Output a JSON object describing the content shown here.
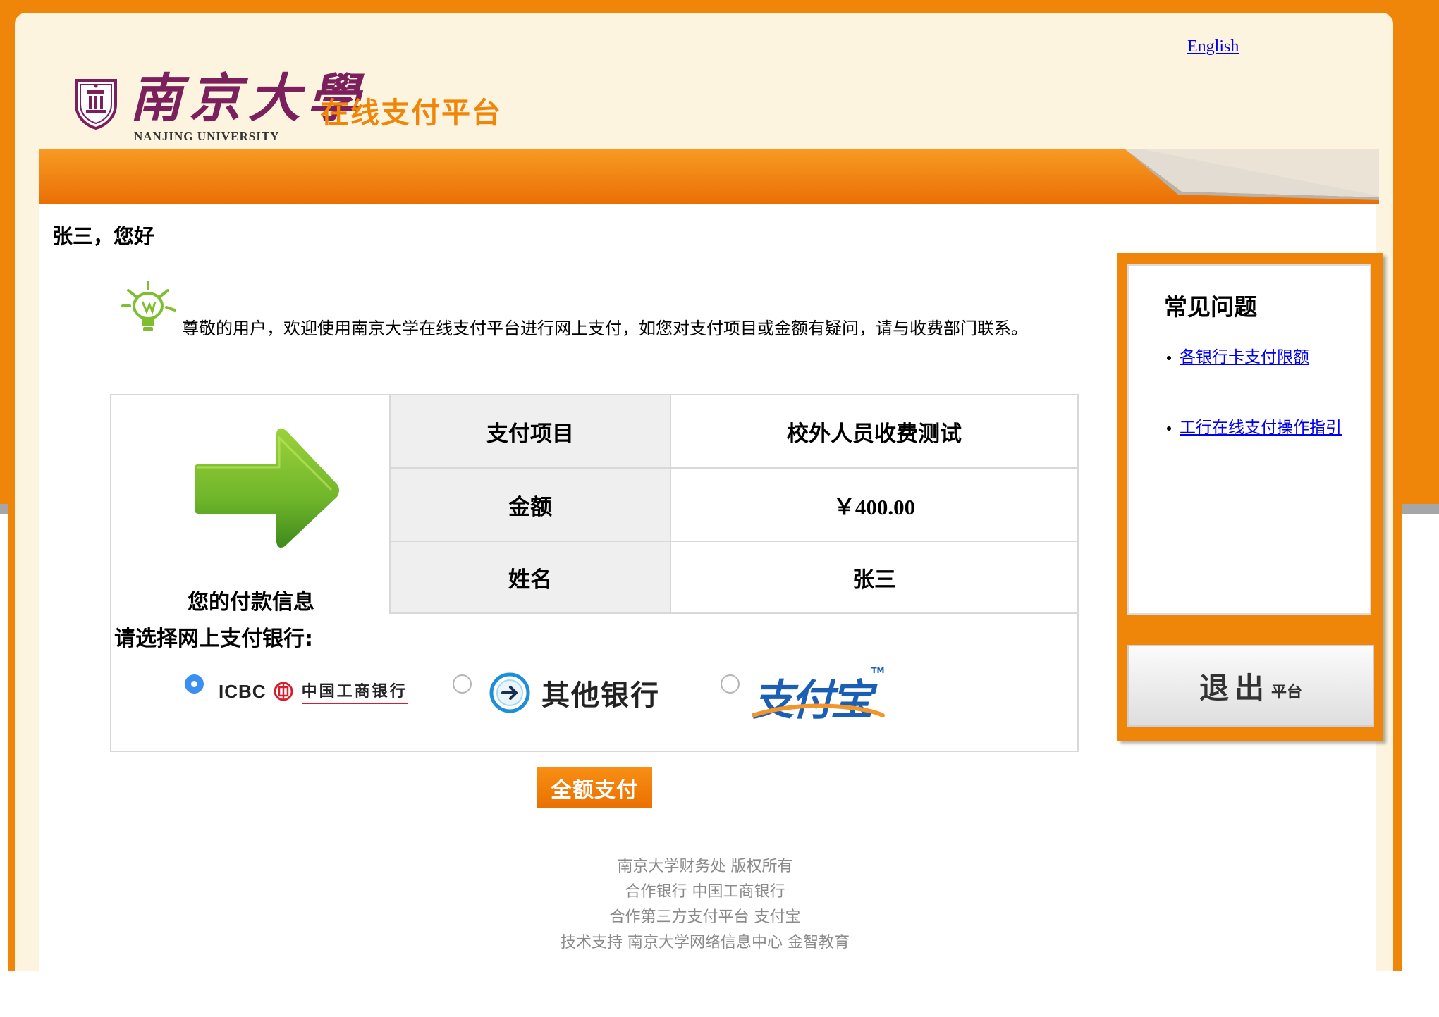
{
  "header": {
    "language_link": "English",
    "logo_cn": "南京大學",
    "logo_en": "NANJING UNIVERSITY",
    "platform_title": "在线支付平台"
  },
  "greeting": "张三，您好",
  "welcome_message": "尊敬的用户，欢迎使用南京大学在线支付平台进行网上支付，如您对支付项目或金额有疑问，请与收费部门联系。",
  "payment_info": {
    "caption": "您的付款信息",
    "rows": [
      {
        "label": "支付项目",
        "value": "校外人员收费测试"
      },
      {
        "label": "金额",
        "value": "￥400.00"
      },
      {
        "label": "姓名",
        "value": "张三"
      }
    ]
  },
  "bank_selection": {
    "prompt": "请选择网上支付银行:",
    "options": [
      {
        "id": "icbc",
        "logo_en": "ICBC",
        "logo_cn": "中国工商银行",
        "selected": true
      },
      {
        "id": "other",
        "label": "其他银行",
        "selected": false
      },
      {
        "id": "alipay",
        "label": "支付宝",
        "trademark": "TM",
        "selected": false
      }
    ]
  },
  "pay_button": "全额支付",
  "footer": [
    "南京大学财务处 版权所有",
    "合作银行 中国工商银行",
    "合作第三方支付平台 支付宝",
    "技术支持 南京大学网络信息中心 金智教育"
  ],
  "faq": {
    "title": "常见问题",
    "items": [
      "各银行卡支付限额",
      "工行在线支付操作指引"
    ]
  },
  "exit_button": {
    "main": "退出",
    "sub": "平台"
  },
  "colors": {
    "brand_orange": "#ef8609",
    "card_cream": "#fdf4df",
    "nju_purple": "#7b1f5d",
    "link_blue": "#0000ee",
    "radio_blue": "#3a8ff0",
    "footer_grey": "#8a8a8a"
  },
  "icons": {
    "tip": "lightbulb-icon",
    "arrow": "right-arrow-icon",
    "crest": "nju-crest-icon",
    "icbc": "icbc-logo-icon",
    "other_bank": "arrow-circle-icon",
    "alipay": "alipay-logo-icon"
  }
}
